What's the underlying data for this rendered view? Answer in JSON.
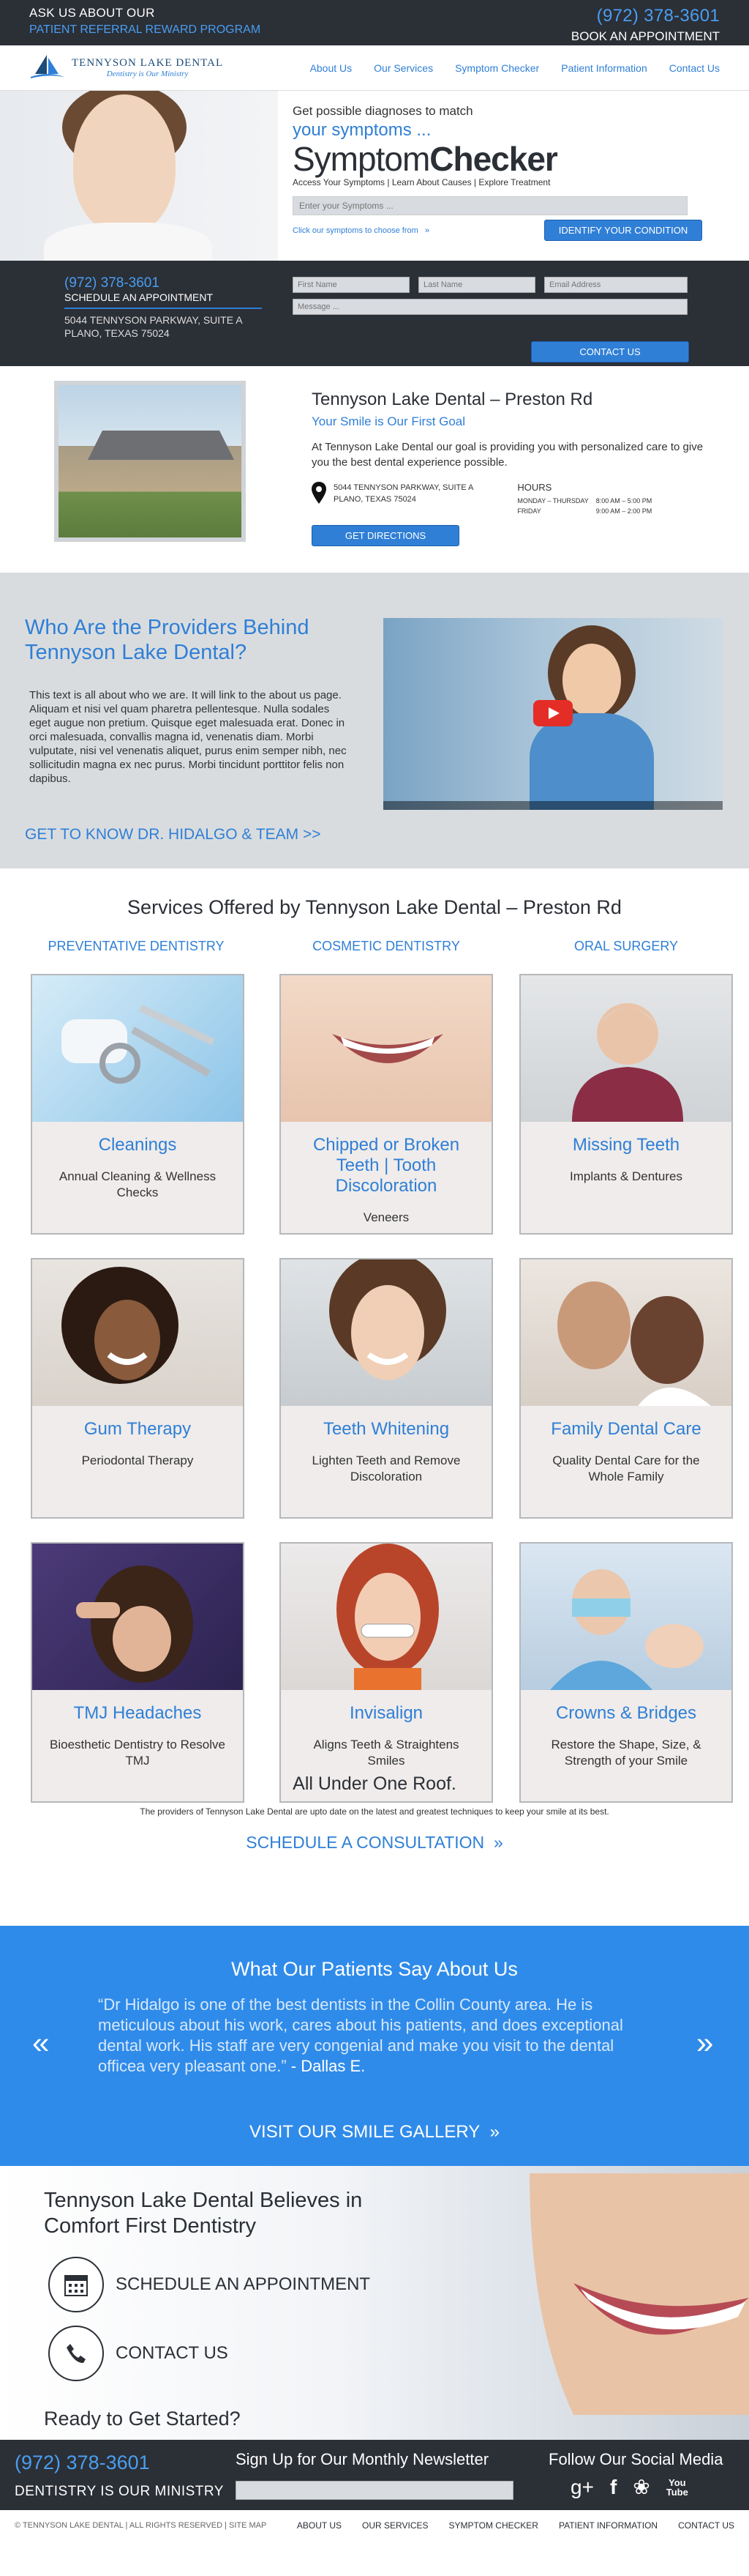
{
  "topbar": {
    "left_line1": "ASK US ABOUT OUR",
    "left_line2": "PATIENT REFERRAL REWARD PROGRAM",
    "phone": "(972) 378-3601",
    "book": "BOOK AN APPOINTMENT"
  },
  "logo": {
    "name": "TENNYSON LAKE DENTAL",
    "tagline": "Dentistry is Our Ministry"
  },
  "nav": [
    "About Us",
    "Our Services",
    "Symptom Checker",
    "Patient Information",
    "Contact Us"
  ],
  "symptom": {
    "sub1": "Get possible diagnoses to match",
    "sub2": "your symptoms ...",
    "title_light": "Symptom",
    "title_bold": "Checker",
    "tagline": "Access Your Symptoms | Learn About Causes | Explore Treatment",
    "input_placeholder": "Enter your Symptoms ...",
    "hint": "Click our symptoms to choose from",
    "hint_arrows": "»",
    "button": "IDENTIFY YOUR CONDITION"
  },
  "contact": {
    "phone": "(972) 378-3601",
    "schedule": "SCHEDULE AN APPOINTMENT",
    "address1": "5044 TENNYSON PARKWAY, SUITE A",
    "address2": "PLANO, TEXAS 75024",
    "first_name": "First Name",
    "last_name": "Last Name",
    "email": "Email Address",
    "message": "Message ...",
    "button": "CONTACT US"
  },
  "location": {
    "title": "Tennyson Lake Dental – Preston Rd",
    "slogan": "Your Smile is Our First Goal",
    "text": "At Tennyson Lake Dental our goal is providing you with personalized care to give you the best dental experience possible.",
    "address1": "5044 TENNYSON PARKWAY, SUITE A",
    "address2": "PLANO, TEXAS 75024",
    "hours_title": "HOURS",
    "hours": [
      {
        "day": "MONDAY – THURSDAY",
        "time": "8:00 AM – 5:00 PM"
      },
      {
        "day": "FRIDAY",
        "time": "9:00 AM – 2:00 PM"
      }
    ],
    "button": "GET DIRECTIONS"
  },
  "providers": {
    "title": "Who Are the Providers Behind Tennyson Lake Dental?",
    "text": "This text is all about who we are. It will link to the about us page. Aliquam et nisi vel quam pharetra pellentesque. Nulla sodales eget augue non pretium. Quisque eget malesuada erat. Donec in orci malesuada, convallis magna id, venenatis diam. Morbi vulputate, nisi vel venenatis aliquet, purus enim semper nibh, nec sollicitudin magna ex nec purus. Morbi tincidunt porttitor felis non dapibus.",
    "link": "GET TO KNOW DR. HIDALGO & TEAM >>"
  },
  "services": {
    "title": "Services Offered by Tennyson Lake Dental – Preston Rd",
    "categories": [
      "PREVENTATIVE DENTISTRY",
      "COSMETIC DENTISTRY",
      "ORAL SURGERY"
    ],
    "cards": [
      {
        "title": "Cleanings",
        "desc": "Annual Cleaning & Wellness Checks"
      },
      {
        "title": "Chipped or Broken Teeth | Tooth Discoloration",
        "desc": "Veneers"
      },
      {
        "title": "Missing Teeth",
        "desc": "Implants & Dentures"
      },
      {
        "title": "Gum Therapy",
        "desc": "Periodontal Therapy"
      },
      {
        "title": "Teeth Whitening",
        "desc": "Lighten Teeth and Remove Discoloration"
      },
      {
        "title": "Family Dental Care",
        "desc": "Quality Dental Care for the Whole Family"
      },
      {
        "title": "TMJ  Headaches",
        "desc": "Bioesthetic Dentistry to Resolve TMJ"
      },
      {
        "title": "Invisalign",
        "desc": "Aligns Teeth & Straightens Smiles"
      },
      {
        "title": "Crowns & Bridges",
        "desc": "Restore the Shape, Size, & Strength of your Smile"
      }
    ]
  },
  "roof": {
    "title": "All Under One Roof.",
    "text": "The providers of Tennyson Lake Dental are upto date on the latest and greatest techniques to keep your smile at its best.",
    "link": "SCHEDULE A CONSULTATION",
    "link_arrows": "»"
  },
  "testimonials": {
    "title": "What Our Patients Say About Us",
    "quote": "“Dr Hidalgo is one of the best dentists in the Collin County area. He is meticulous about his work, cares about his patients, and does exceptional dental work. His staff are very congenial and make you visit to the dental officea very pleasant one.”",
    "author": "- Dallas E.",
    "prev": "«",
    "next": "»",
    "gallery": "VISIT OUR SMILE GALLERY",
    "gallery_arrows": "»"
  },
  "comfort": {
    "title": "Tennyson Lake Dental Believes in Comfort First Dentistry",
    "schedule": "SCHEDULE AN APPOINTMENT",
    "contact": "CONTACT US",
    "ready": "Ready to Get Started?"
  },
  "footer": {
    "phone": "(972) 378-3601",
    "ministry": "DENTISTRY IS OUR MINISTRY",
    "newsletter": "Sign Up for Our Monthly Newsletter",
    "social": "Follow Our Social Media",
    "social_icons": [
      "google-plus-icon",
      "facebook-icon",
      "yelp-icon",
      "youtube-icon"
    ],
    "social_labels": {
      "gplus": "g+",
      "facebook": "f",
      "yelp": "❀",
      "youtube_top": "You",
      "youtube_bottom": "Tube"
    },
    "copyright": "© TENNYSON LAKE DENTAL | ALL RIGHTS RESERVED | SITE MAP",
    "links": [
      "ABOUT US",
      "OUR SERVICES",
      "SYMPTOM CHECKER",
      "PATIENT INFORMATION",
      "CONTACT US"
    ]
  },
  "colors": {
    "accent": "#2f7fd6",
    "dark": "#2b2f36",
    "testimonial_bg": "#2f8bea",
    "card_bg": "#efeceb"
  }
}
